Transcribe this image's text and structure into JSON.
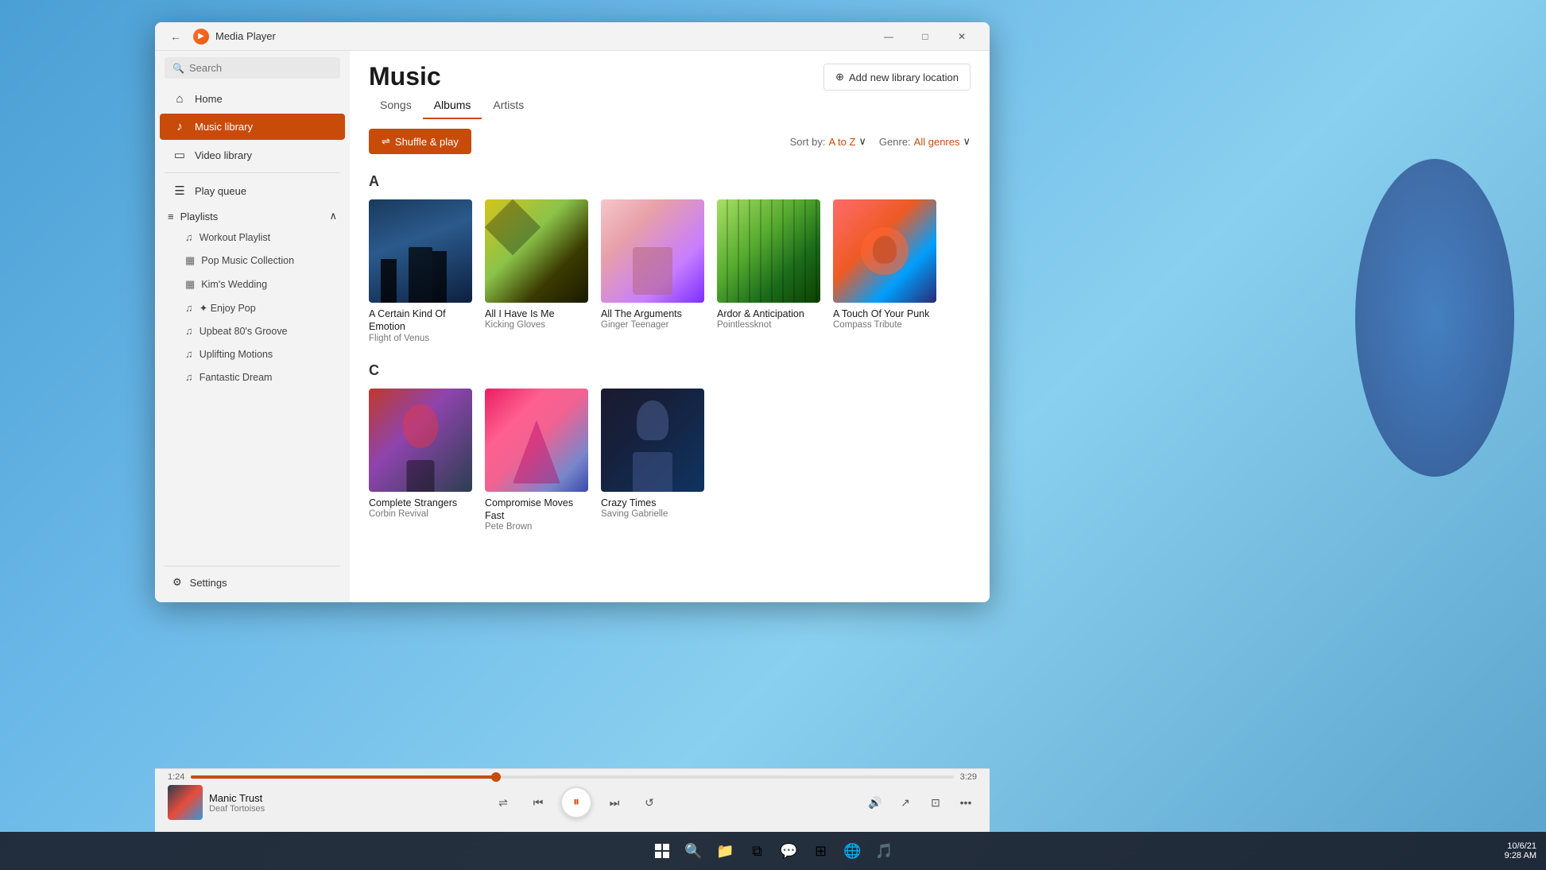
{
  "window": {
    "title": "Media Player",
    "icon": "🎵"
  },
  "sidebar": {
    "search_placeholder": "Search",
    "nav_items": [
      {
        "id": "home",
        "label": "Home",
        "icon": "⌂"
      },
      {
        "id": "music-library",
        "label": "Music library",
        "icon": "♪",
        "active": true
      },
      {
        "id": "video-library",
        "label": "Video library",
        "icon": "□"
      }
    ],
    "play_queue": {
      "label": "Play queue",
      "icon": "☰"
    },
    "playlists": {
      "label": "Playlists",
      "items": [
        {
          "id": "workout",
          "label": "Workout Playlist",
          "icon": "♫"
        },
        {
          "id": "pop",
          "label": "Pop Music Collection",
          "icon": "▦"
        },
        {
          "id": "kims-wedding",
          "label": "Kim's Wedding",
          "icon": "▦"
        },
        {
          "id": "enjoy-pop",
          "label": "✦ Enjoy Pop",
          "icon": "♫",
          "star": true
        },
        {
          "id": "upbeat",
          "label": "Upbeat 80's Groove",
          "icon": "♫"
        },
        {
          "id": "uplifting",
          "label": "Uplifting Motions",
          "icon": "♫"
        },
        {
          "id": "fantastic",
          "label": "Fantastic Dream",
          "icon": "♫"
        }
      ]
    },
    "settings_label": "Settings",
    "settings_icon": "⚙"
  },
  "main": {
    "title": "Music",
    "tabs": [
      {
        "id": "songs",
        "label": "Songs",
        "active": false
      },
      {
        "id": "albums",
        "label": "Albums",
        "active": true
      },
      {
        "id": "artists",
        "label": "Artists",
        "active": false
      }
    ],
    "add_library_btn": "Add new library location",
    "shuffle_btn": "Shuffle & play",
    "sort": {
      "label": "Sort by:",
      "value": "A to Z"
    },
    "genre": {
      "label": "Genre:",
      "value": "All genres"
    },
    "sections": [
      {
        "letter": "A",
        "albums": [
          {
            "id": "a1",
            "title": "A Certain Kind Of Emotion",
            "artist": "Flight of Venus",
            "art_class": "art-1"
          },
          {
            "id": "a2",
            "title": "All I Have Is Me",
            "artist": "Kicking Gloves",
            "art_class": "art-2"
          },
          {
            "id": "a3",
            "title": "All The Arguments",
            "artist": "Ginger Teenager",
            "art_class": "art-3"
          },
          {
            "id": "a4",
            "title": "Ardor & Anticipation",
            "artist": "Pointlessknot",
            "art_class": "art-4"
          },
          {
            "id": "a5",
            "title": "A Touch Of Your Punk",
            "artist": "Compass Tribute",
            "art_class": "art-5"
          }
        ]
      },
      {
        "letter": "C",
        "albums": [
          {
            "id": "c1",
            "title": "Complete Strangers",
            "artist": "Corbin Revival",
            "art_class": "art-c1"
          },
          {
            "id": "c2",
            "title": "Compromise Moves Fast",
            "artist": "Pete Brown",
            "art_class": "art-c2"
          },
          {
            "id": "c3",
            "title": "Crazy Times",
            "artist": "Saving Gabrielle",
            "art_class": "art-c3"
          }
        ]
      }
    ]
  },
  "player": {
    "track_name": "Manic Trust",
    "track_artist": "Deaf Tortoises",
    "current_time": "1:24",
    "total_time": "3:29",
    "progress_percent": 40
  },
  "taskbar": {
    "datetime": "10/6/21\n9:28 AM"
  },
  "window_controls": {
    "minimize": "—",
    "maximize": "□",
    "close": "✕"
  }
}
